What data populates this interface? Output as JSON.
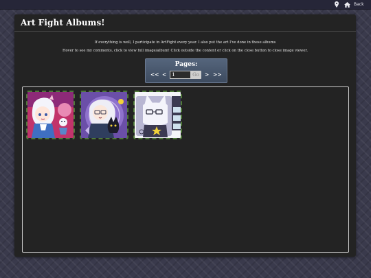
{
  "topbar": {
    "pin_icon": "map-pin-icon",
    "home_icon": "home-icon",
    "back_label": "Back"
  },
  "panel": {
    "title": "Art Fight Albums!",
    "intro_line_1": "If everything is well, I participate in ArtFight every year. I also put the art I've done in these albums",
    "intro_line_2": "Hover to see my comments, click to view full image/album! Click outside the content or click on the close button to close image viewer."
  },
  "pager": {
    "label": "Pages:",
    "first": "<<",
    "prev": "<",
    "page_value": "1",
    "go": "Go",
    "next": ">",
    "last": ">>"
  },
  "gallery": {
    "thumbnails": [
      {
        "name": "album-thumbnail-1",
        "palette": [
          "#c2336b",
          "#ffffff",
          "#5a86c9"
        ]
      },
      {
        "name": "album-thumbnail-2",
        "palette": [
          "#7a5ab8",
          "#e8e8f2",
          "#3a5a8a"
        ]
      },
      {
        "name": "album-thumbnail-3",
        "palette": [
          "#b8b6d2",
          "#3c3a52",
          "#f2d23a"
        ]
      }
    ]
  }
}
